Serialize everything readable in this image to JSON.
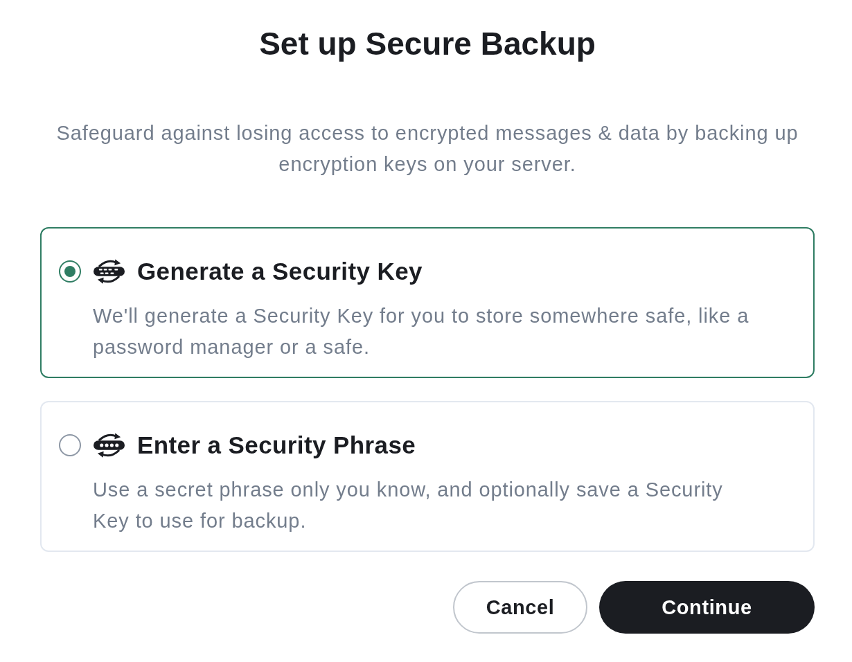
{
  "title": "Set up Secure Backup",
  "description": "Safeguard against losing access to encrypted messages & data by backing up encryption keys on your server.",
  "options": [
    {
      "kind": "key",
      "title": "Generate a Security Key",
      "description": "We'll generate a Security Key for you to store somewhere safe, like a password manager or a safe.",
      "selected": true
    },
    {
      "kind": "phrase",
      "title": "Enter a Security Phrase",
      "description": "Use a secret phrase only you know, and optionally save a Security Key to use for backup.",
      "selected": false
    }
  ],
  "buttons": [
    {
      "kind": "secondary",
      "label": "Cancel"
    },
    {
      "kind": "primary",
      "label": "Continue"
    }
  ]
}
